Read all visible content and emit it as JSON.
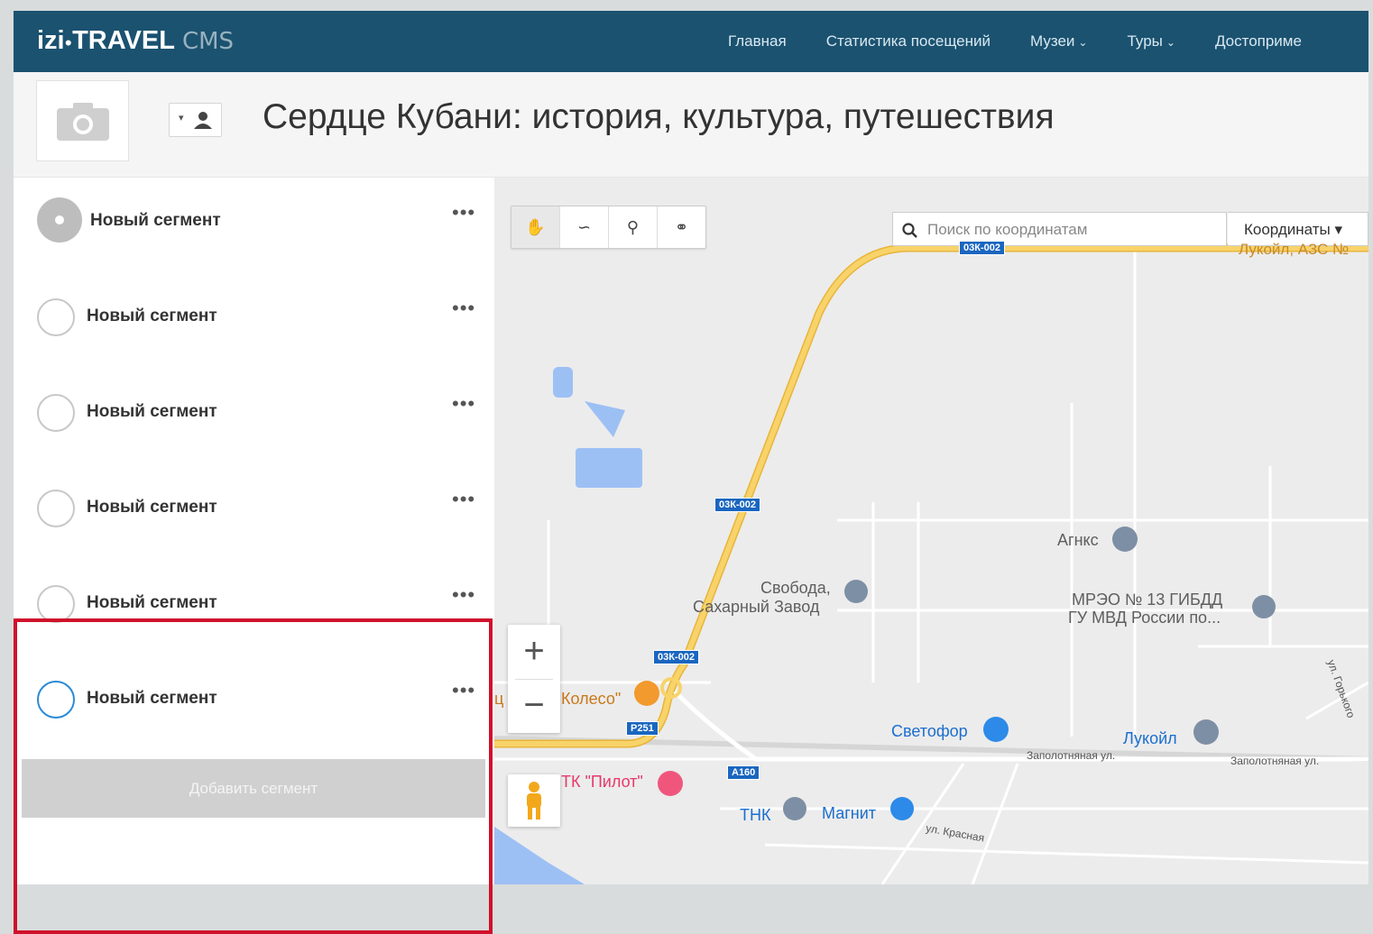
{
  "nav": {
    "logo_brand": "izi",
    "logo_dot": "●",
    "logo_travel": "TRAVEL",
    "logo_cms": "CMS",
    "links": [
      {
        "label": "Главная",
        "dropdown": false
      },
      {
        "label": "Статистика посещений",
        "dropdown": false
      },
      {
        "label": "Музеи",
        "dropdown": true
      },
      {
        "label": "Туры",
        "dropdown": true
      },
      {
        "label": "Достоприме",
        "dropdown": false
      }
    ]
  },
  "header": {
    "title": "Сердце Кубани: история, культура, путешествия"
  },
  "segments": [
    {
      "label": "Новый сегмент",
      "state": "filled"
    },
    {
      "label": "Новый сегмент",
      "state": "empty"
    },
    {
      "label": "Новый сегмент",
      "state": "empty"
    },
    {
      "label": "Новый сегмент",
      "state": "empty"
    },
    {
      "label": "Новый сегмент",
      "state": "empty"
    },
    {
      "label": "Новый сегмент",
      "state": "active"
    }
  ],
  "segment_menu": "•••",
  "add_segment_label": "Добавить сегмент",
  "map": {
    "search_placeholder": "Поиск по координатам",
    "coords_dropdown": "Координаты ▾",
    "zoom_in": "+",
    "zoom_out": "−",
    "labels": {
      "lukoil_top": "Лукойл, АЗС №",
      "agnks": "Агнкс",
      "svoboda1": "Свобода,",
      "svoboda2": "Сахарный Завод",
      "mreo1": "МРЭО № 13 ГИБДД",
      "mreo2": "ГУ МВД России по...",
      "koleso": "Колесо\"",
      "koleso_prefix": "ц",
      "svetofor": "Светофор",
      "lukoil": "Лукойл",
      "pilot": "ТК \"Пилот\"",
      "tnk": "ТНК",
      "magnit": "Магнит",
      "zapolot1": "Заполотняная ул.",
      "zapolot2": "Заполотняная ул.",
      "krasnaya": "ул. Красная",
      "gorkogo": "ул. Горького"
    },
    "shields": {
      "s1": "03К-002",
      "s2": "03К-002",
      "s3": "03К-002",
      "s4": "Р251",
      "s5": "А160"
    }
  },
  "colors": {
    "nav_bg": "#1b5270",
    "highlight": "#d0102b",
    "active_radio": "#2b8ad6",
    "road_yellow": "#f4c64c"
  }
}
